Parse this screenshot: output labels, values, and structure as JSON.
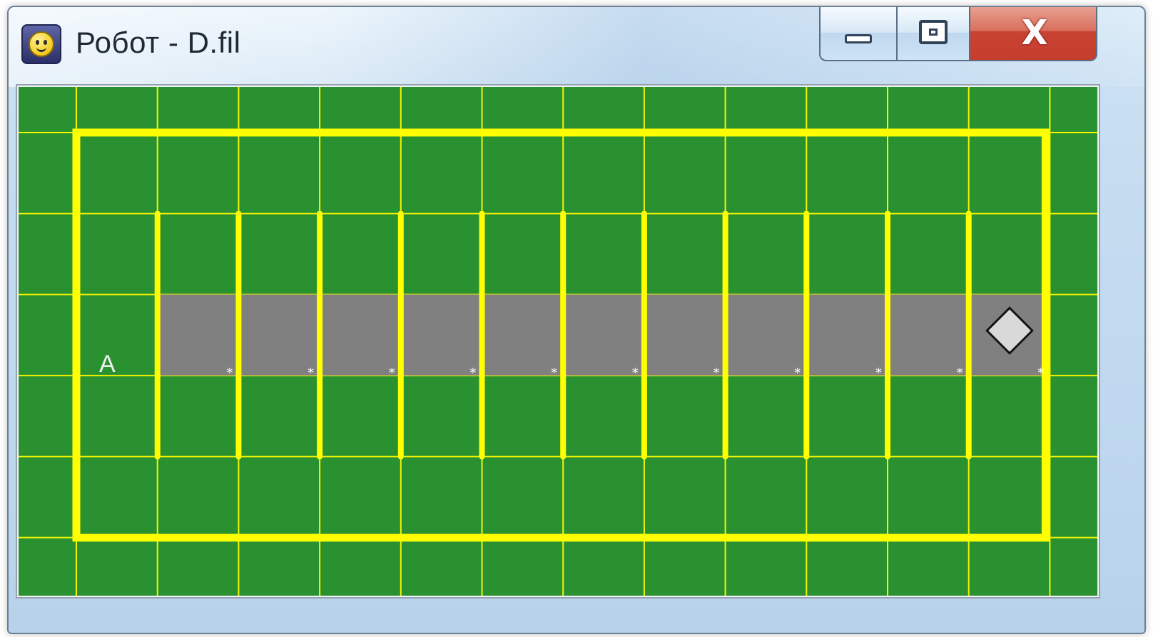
{
  "window": {
    "title": "Робот - D.fil"
  },
  "titlebar": {
    "icon": "smiley-icon",
    "buttons": [
      "minimize",
      "maximize",
      "close"
    ]
  },
  "board": {
    "background": "#2a9130",
    "gridColor": "#f5f500",
    "wallColor": "#ffff00",
    "paintedColor": "#808080",
    "robotColor": "#d9d9d9",
    "labels": [
      "A"
    ]
  }
}
